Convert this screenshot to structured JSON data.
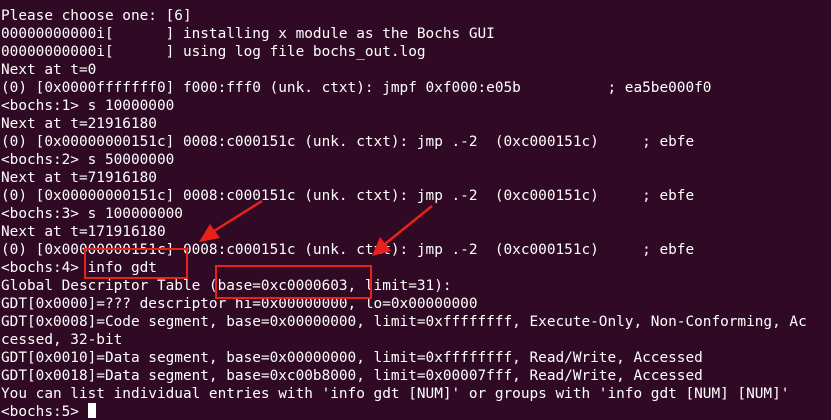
{
  "terminal": {
    "lines": [
      "Please choose one: [6]",
      "00000000000i[      ] installing x module as the Bochs GUI",
      "00000000000i[      ] using log file bochs_out.log",
      "Next at t=0",
      "(0) [0x0000fffffff0] f000:fff0 (unk. ctxt): jmpf 0xf000:e05b          ; ea5be000f0",
      "<bochs:1> s 10000000",
      "Next at t=21916180",
      "(0) [0x00000000151c] 0008:c000151c (unk. ctxt): jmp .-2  (0xc000151c)     ; ebfe",
      "<bochs:2> s 50000000",
      "Next at t=71916180",
      "(0) [0x00000000151c] 0008:c000151c (unk. ctxt): jmp .-2  (0xc000151c)     ; ebfe",
      "<bochs:3> s 100000000",
      "Next at t=171916180",
      "(0) [0x00000000151c] 0008:c000151c (unk. ctxt): jmp .-2  (0xc000151c)     ; ebfe",
      "<bochs:4> info gdt",
      "Global Descriptor Table (base=0xc0000603, limit=31):",
      "GDT[0x0000]=??? descriptor hi=0x00000000, lo=0x00000000",
      "GDT[0x0008]=Code segment, base=0x00000000, limit=0xffffffff, Execute-Only, Non-Conforming, Ac",
      "cessed, 32-bit",
      "GDT[0x0010]=Data segment, base=0x00000000, limit=0xffffffff, Read/Write, Accessed",
      "GDT[0x0018]=Data segment, base=0xc00b8000, limit=0x00007fff, Read/Write, Accessed",
      "You can list individual entries with 'info gdt [NUM]' or groups with 'info gdt [NUM] [NUM]'",
      "<bochs:5> "
    ]
  },
  "colors": {
    "background": "#300a24",
    "text": "#ffffff",
    "annotation": "#e8211c"
  }
}
